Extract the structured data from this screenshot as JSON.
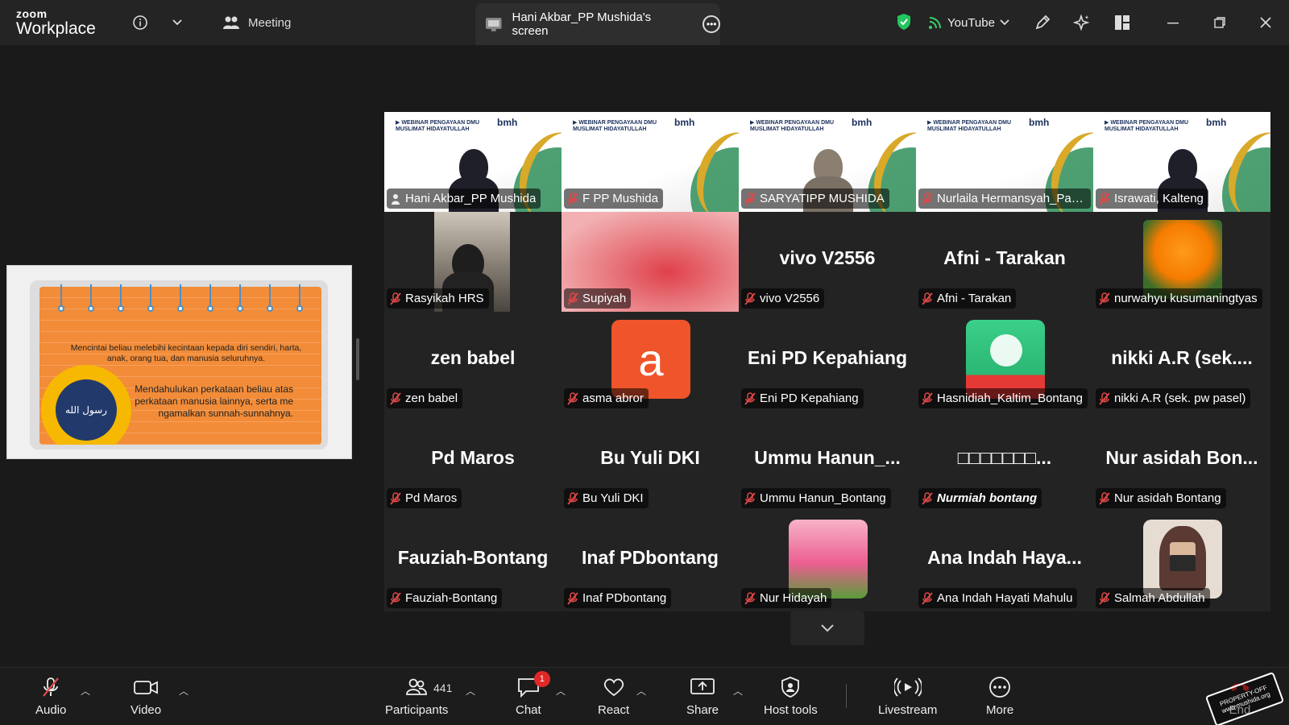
{
  "app": {
    "logo_line1": "zoom",
    "logo_line2": "Workplace"
  },
  "topbar": {
    "meeting_label": "Meeting",
    "screen_tab_label": "Hani Akbar_PP Mushida's screen",
    "livestream_target": "YouTube"
  },
  "slide": {
    "text1": "Mencintai beliau melebihi kecintaan kepada diri sendiri, harta, anak, orang tua, dan manusia seluruhnya.",
    "text2": "Mendahulukan perkataan beliau atas perkataan manusia lainnya, serta me ngamalkan sunnah-sunnahnya.",
    "arabic": "رسول الله"
  },
  "participants": [
    {
      "label": "Hani Akbar_PP Mushida",
      "kind": "banner",
      "active": true,
      "mic": "host"
    },
    {
      "label": "F PP Mushida",
      "kind": "banner"
    },
    {
      "label": "SARYATIPP MUSHIDA",
      "kind": "banner"
    },
    {
      "label": "Nurlaila Hermansyah_Pas...",
      "kind": "banner"
    },
    {
      "label": "Israwati, Kalteng",
      "kind": "banner"
    },
    {
      "label": "Rasyikah HRS",
      "kind": "photo"
    },
    {
      "label": "Supiyah",
      "kind": "blur"
    },
    {
      "label": "vivo V2556",
      "kind": "name",
      "bigname": "vivo V2556"
    },
    {
      "label": "Afni - Tarakan",
      "kind": "name",
      "bigname": "Afni - Tarakan"
    },
    {
      "label": "nurwahyu kusumaningtyas",
      "kind": "flower"
    },
    {
      "label": "zen babel",
      "kind": "name",
      "bigname": "zen babel"
    },
    {
      "label": "asma abror",
      "kind": "avatar",
      "letter": "a"
    },
    {
      "label": "Eni PD Kepahiang",
      "kind": "name",
      "bigname": "Eni PD Kepahiang"
    },
    {
      "label": "Hasnidiah_Kaltim_Bontang",
      "kind": "vase"
    },
    {
      "label": "nikki A.R (sek. pw pasel)",
      "kind": "name",
      "bigname": "nikki A.R (sek...."
    },
    {
      "label": "Pd Maros",
      "kind": "name",
      "bigname": "Pd Maros"
    },
    {
      "label": "Bu Yuli DKI",
      "kind": "name",
      "bigname": "Bu Yuli DKI"
    },
    {
      "label": "Ummu Hanun_Bontang",
      "kind": "name",
      "bigname": "Ummu Hanun_..."
    },
    {
      "label": "Nurmiah bontang",
      "kind": "name",
      "bigname": "□□□□□□□...",
      "italic": true
    },
    {
      "label": "Nur asidah Bontang",
      "kind": "name",
      "bigname": "Nur asidah Bon..."
    },
    {
      "label": "Fauziah-Bontang",
      "kind": "name",
      "bigname": "Fauziah-Bontang"
    },
    {
      "label": "Inaf PDbontang",
      "kind": "name",
      "bigname": "Inaf PDbontang"
    },
    {
      "label": "Nur Hidayah",
      "kind": "tulips"
    },
    {
      "label": "Ana Indah Hayati Mahulu",
      "kind": "name",
      "bigname": "Ana Indah Haya..."
    },
    {
      "label": "Salmah Abdullah",
      "kind": "portrait"
    }
  ],
  "toolbar": {
    "audio": "Audio",
    "video": "Video",
    "participants": "Participants",
    "participants_count": "441",
    "chat": "Chat",
    "chat_badge": "1",
    "react": "React",
    "share": "Share",
    "host_tools": "Host tools",
    "livestream": "Livestream",
    "more": "More",
    "end": "End"
  },
  "watermark": {
    "line1": "PROPERTY-OFF",
    "line2": "www.mushida.org"
  },
  "colors": {
    "active_border": "#3ccd6a",
    "badge_red": "#e02828",
    "mic_off_red": "#e04848",
    "shield_green": "#22c55e"
  }
}
